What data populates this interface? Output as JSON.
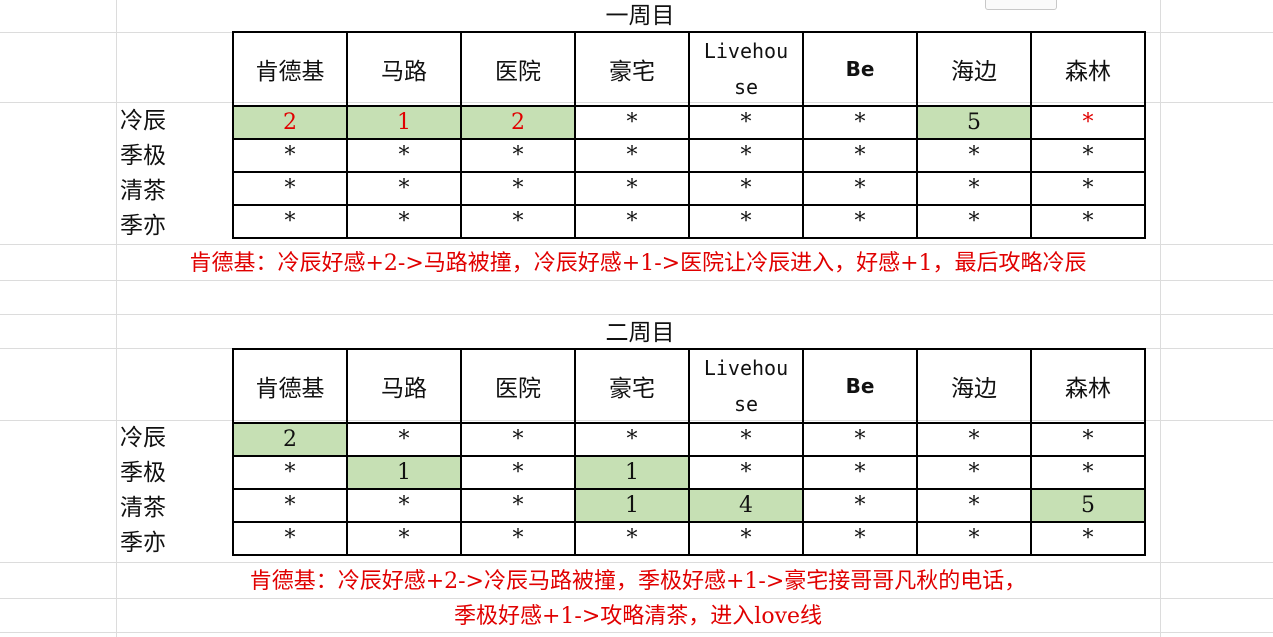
{
  "cycles": [
    {
      "title": "一周目",
      "headers": [
        "肯德基",
        "马路",
        "医院",
        "豪宅",
        "Livehou\nse",
        "Be",
        "海边",
        "森林"
      ],
      "rows": [
        {
          "label": "冷辰",
          "cells": [
            "2",
            "1",
            "2",
            "*",
            "*",
            "*",
            "5",
            "*"
          ]
        },
        {
          "label": "季极",
          "cells": [
            "*",
            "*",
            "*",
            "*",
            "*",
            "*",
            "*",
            "*"
          ]
        },
        {
          "label": "清茶",
          "cells": [
            "*",
            "*",
            "*",
            "*",
            "*",
            "*",
            "*",
            "*"
          ]
        },
        {
          "label": "季亦",
          "cells": [
            "*",
            "*",
            "*",
            "*",
            "*",
            "*",
            "*",
            "*"
          ]
        }
      ],
      "note": "肯德基：冷辰好感+2->马路被撞，冷辰好感+1->医院让冷辰进入，好感+1，最后攻略冷辰"
    },
    {
      "title": "二周目",
      "headers": [
        "肯德基",
        "马路",
        "医院",
        "豪宅",
        "Livehou\nse",
        "Be",
        "海边",
        "森林"
      ],
      "rows": [
        {
          "label": "冷辰",
          "cells": [
            "2",
            "*",
            "*",
            "*",
            "*",
            "*",
            "*",
            "*"
          ]
        },
        {
          "label": "季极",
          "cells": [
            "*",
            "1",
            "*",
            "1",
            "*",
            "*",
            "*",
            "*"
          ]
        },
        {
          "label": "清茶",
          "cells": [
            "*",
            "*",
            "*",
            "1",
            "4",
            "*",
            "*",
            "5"
          ]
        },
        {
          "label": "季亦",
          "cells": [
            "*",
            "*",
            "*",
            "*",
            "*",
            "*",
            "*",
            "*"
          ]
        }
      ],
      "note_line1": "肯德基：冷辰好感+2->冷辰马路被撞，季极好感+1->豪宅接哥哥凡秋的电话，",
      "note_line2": "季极好感+1->攻略清茶，进入love线"
    }
  ],
  "colors": {
    "highlight": "#c6e0b4",
    "note_text": "#e00000"
  }
}
